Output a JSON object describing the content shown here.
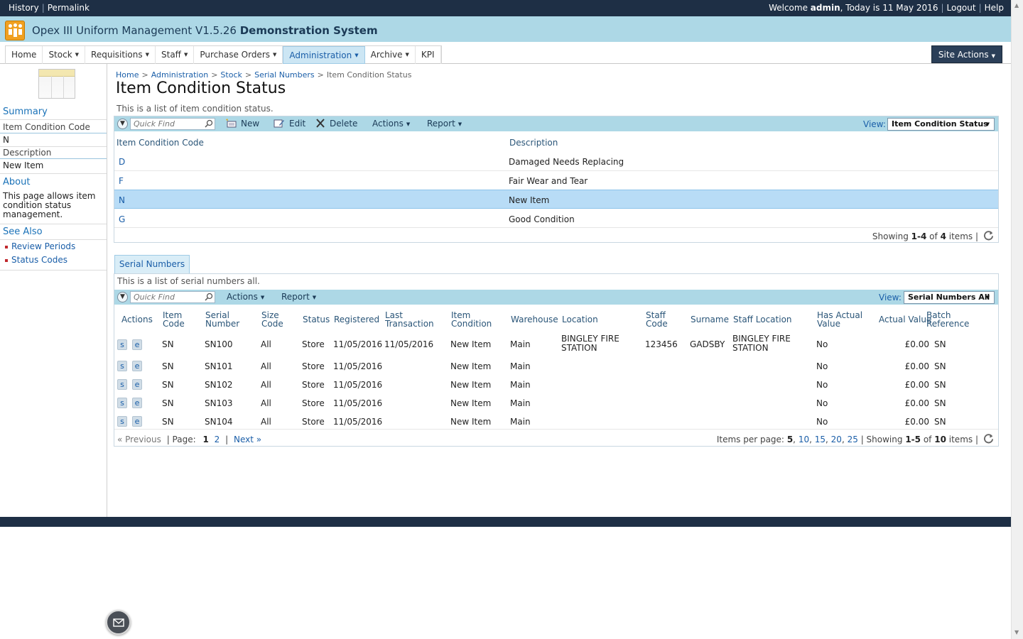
{
  "topbar": {
    "history": "History",
    "permalink": "Permalink",
    "welcome_prefix": "Welcome",
    "user": "admin",
    "date_text": ", Today is 11 May 2016",
    "logout": "Logout",
    "help": "Help"
  },
  "app": {
    "title_prefix": "Opex III Uniform Management V1.5.26",
    "title_bold": "Demonstration System"
  },
  "nav": {
    "tabs": [
      "Home",
      "Stock",
      "Requisitions",
      "Staff",
      "Purchase Orders",
      "Administration",
      "Archive",
      "KPI"
    ],
    "active": "Administration",
    "site_actions": "Site Actions"
  },
  "sidebar": {
    "summary_title": "Summary",
    "field1_label": "Item Condition Code",
    "field1_value": "N",
    "field2_label": "Description",
    "field2_value": "New Item",
    "about_title": "About",
    "about_text": "This page allows item condition status management.",
    "see_also_title": "See Also",
    "links": [
      "Review Periods",
      "Status Codes"
    ]
  },
  "breadcrumb": [
    "Home",
    "Administration",
    "Stock",
    "Serial Numbers",
    "Item Condition Status"
  ],
  "page": {
    "title": "Item Condition Status",
    "description": "This is a list of item condition status."
  },
  "grid1": {
    "quickfind_placeholder": "Quick Find",
    "toolbar": {
      "new": "New",
      "edit": "Edit",
      "delete": "Delete",
      "actions": "Actions",
      "report": "Report"
    },
    "view_label": "View:",
    "view_value": "Item Condition Status",
    "columns": [
      "Item Condition Code",
      "Description"
    ],
    "rows": [
      {
        "code": "D",
        "description": "Damaged Needs Replacing"
      },
      {
        "code": "F",
        "description": "Fair Wear and Tear"
      },
      {
        "code": "N",
        "description": "New Item"
      },
      {
        "code": "G",
        "description": "Good Condition"
      }
    ],
    "selected_code": "N",
    "footer": {
      "showing": "Showing",
      "range": "1-4",
      "of": "of",
      "total": "4",
      "items": "items |"
    }
  },
  "grid2": {
    "tab": "Serial Numbers",
    "description": "This is a list of serial numbers all.",
    "quickfind_placeholder": "Quick Find",
    "toolbar": {
      "actions": "Actions",
      "report": "Report"
    },
    "view_label": "View:",
    "view_value": "Serial Numbers All",
    "columns": [
      "Actions",
      "Item Code",
      "Serial Number",
      "Size Code",
      "Status",
      "Registered",
      "Last Transaction",
      "Item Condition",
      "Warehouse",
      "Location",
      "Staff Code",
      "Surname",
      "Staff Location",
      "Has Actual Value",
      "Actual Value",
      "Batch Reference"
    ],
    "rows": [
      {
        "item_code": "SN",
        "serial": "SN100",
        "size": "All",
        "status": "Store",
        "registered": "11/05/2016",
        "last": "11/05/2016",
        "condition": "New Item",
        "warehouse": "Main",
        "location": "BINGLEY FIRE STATION",
        "staff_code": "123456",
        "surname": "GADSBY",
        "staff_location": "BINGLEY FIRE STATION",
        "has_actual": "No",
        "actual": "£0.00",
        "batch": "SN"
      },
      {
        "item_code": "SN",
        "serial": "SN101",
        "size": "All",
        "status": "Store",
        "registered": "11/05/2016",
        "last": "",
        "condition": "New Item",
        "warehouse": "Main",
        "location": "",
        "staff_code": "",
        "surname": "",
        "staff_location": "",
        "has_actual": "No",
        "actual": "£0.00",
        "batch": "SN"
      },
      {
        "item_code": "SN",
        "serial": "SN102",
        "size": "All",
        "status": "Store",
        "registered": "11/05/2016",
        "last": "",
        "condition": "New Item",
        "warehouse": "Main",
        "location": "",
        "staff_code": "",
        "surname": "",
        "staff_location": "",
        "has_actual": "No",
        "actual": "£0.00",
        "batch": "SN"
      },
      {
        "item_code": "SN",
        "serial": "SN103",
        "size": "All",
        "status": "Store",
        "registered": "11/05/2016",
        "last": "",
        "condition": "New Item",
        "warehouse": "Main",
        "location": "",
        "staff_code": "",
        "surname": "",
        "staff_location": "",
        "has_actual": "No",
        "actual": "£0.00",
        "batch": "SN"
      },
      {
        "item_code": "SN",
        "serial": "SN104",
        "size": "All",
        "status": "Store",
        "registered": "11/05/2016",
        "last": "",
        "condition": "New Item",
        "warehouse": "Main",
        "location": "",
        "staff_code": "",
        "surname": "",
        "staff_location": "",
        "has_actual": "No",
        "actual": "£0.00",
        "batch": "SN"
      }
    ],
    "action_buttons": [
      "s",
      "e"
    ],
    "footer": {
      "previous": "« Previous",
      "page_label": "| Page:",
      "pages": [
        "1",
        "2"
      ],
      "next": "Next »",
      "per_page_label": "Items per page:",
      "per_page": [
        "5",
        "10",
        "15",
        "20",
        "25"
      ],
      "showing": "| Showing",
      "range": "1-5",
      "of": "of",
      "total": "10",
      "items": "items |"
    }
  },
  "colors": {
    "topbar": "#1e2f45",
    "titlebar": "#add8e6",
    "selected_row": "#b8dcf6",
    "link": "#1a5ea8"
  }
}
